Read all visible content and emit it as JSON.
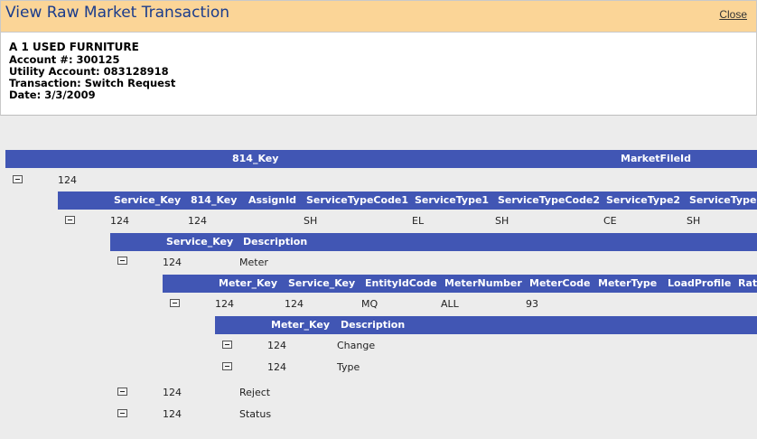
{
  "window": {
    "title": "View Raw Market Transaction",
    "close_label": "Close"
  },
  "header_info": {
    "company": "A 1 USED FURNITURE",
    "account": "Account #: 300125",
    "utility_account": "Utility Account: 083128918",
    "transaction": "Transaction: Switch Request",
    "date": "Date: 3/3/2009"
  },
  "level1": {
    "columns": [
      "814_Key",
      "MarketFileId"
    ],
    "row": [
      "124"
    ]
  },
  "level2": {
    "columns": [
      "Service_Key",
      "814_Key",
      "AssignId",
      "ServiceTypeCode1",
      "ServiceType1",
      "ServiceTypeCode2",
      "ServiceType2",
      "ServiceTypeC"
    ],
    "row": [
      "124",
      "124",
      "SH",
      "EL",
      "SH",
      "CE",
      "SH"
    ]
  },
  "level3": {
    "columns": [
      "Service_Key",
      "Description"
    ],
    "rows": [
      [
        "124",
        "Meter"
      ],
      [
        "124",
        "Reject"
      ],
      [
        "124",
        "Status"
      ]
    ]
  },
  "level4": {
    "columns": [
      "Meter_Key",
      "Service_Key",
      "EntityIdCode",
      "MeterNumber",
      "MeterCode",
      "MeterType",
      "LoadProfile",
      "Rat"
    ],
    "row": [
      "124",
      "124",
      "MQ",
      "ALL",
      "93"
    ]
  },
  "level5": {
    "columns": [
      "Meter_Key",
      "Description"
    ],
    "rows": [
      [
        "124",
        "Change"
      ],
      [
        "124",
        "Type"
      ]
    ]
  }
}
